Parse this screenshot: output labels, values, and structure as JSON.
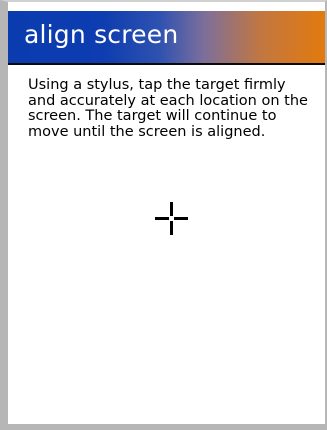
{
  "title": "align screen",
  "instructions": "Using a stylus, tap the target firmly\nand accurately at each location on the\nscreen. The target will continue to\nmove until the screen is aligned.",
  "target": {
    "icon": "crosshair-icon",
    "color": "#000000"
  },
  "colors": {
    "title_gradient_start": "#0a3cb0",
    "title_gradient_end": "#e27a0e",
    "title_text": "#ffffff",
    "background": "#ffffff"
  }
}
